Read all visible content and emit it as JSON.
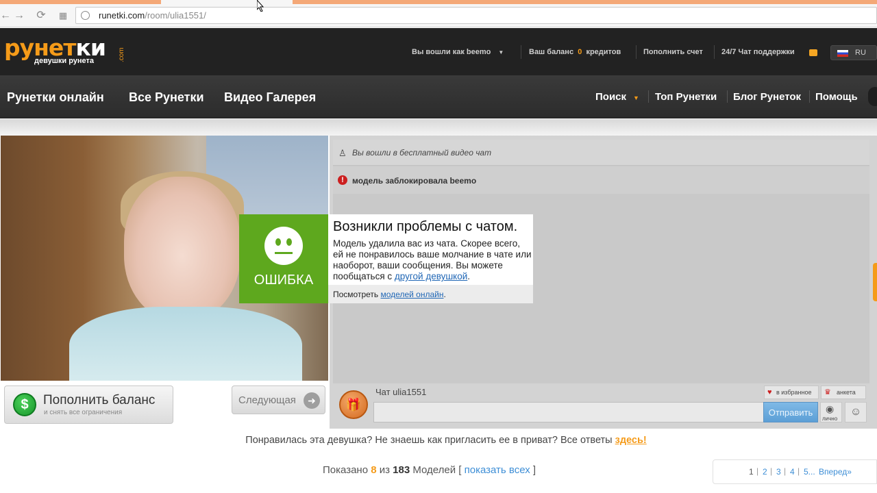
{
  "browser": {
    "url_domain": "runetki.com",
    "url_path": "/room/ulia1551/"
  },
  "header": {
    "logo_word_a": "рунет",
    "logo_word_b": "ки",
    "logo_com": ".com",
    "logo_tagline": "девушки рунета",
    "logged_in_as": "Вы вошли как beemo",
    "balance_label": "Ваш баланс",
    "balance_value": "0",
    "balance_unit": "кредитов",
    "topup": "Пополнить счет",
    "support": "24/7 Чат поддержки",
    "lang": "RU"
  },
  "nav": {
    "left": [
      "Рунетки онлайн",
      "Все Рунетки",
      "Видео Галерея"
    ],
    "search": "Поиск",
    "right": [
      "Топ Рунетки",
      "Блог Рунеток",
      "Помощь"
    ]
  },
  "video": {
    "topup_title": "Пополнить баланс",
    "topup_sub": "и снять все ограничения",
    "next": "Следующая"
  },
  "chat": {
    "msg_free": "Вы вошли в бесплатный видео чат",
    "msg_blocked": "модель заблокировала beemo",
    "title": "Чат ulia1551",
    "fav": "в избранное",
    "profile": "анкета",
    "send": "Отправить",
    "private": "лично"
  },
  "error": {
    "badge": "ОШИБКА",
    "title": "Возникли проблемы с чатом.",
    "body": "Модель удалила вас из чата. Скорее всего, ей не понравилось ваше молчание в чате или наоборот, ваши сообщения. Вы можете пообщаться с",
    "body_link": "другой девушкой",
    "body_end": ".",
    "foot": "Посмотреть",
    "foot_link": "моделей онлайн",
    "foot_end": "."
  },
  "footer": {
    "promo": "Понравилась эта девушка? Не знаешь как пригласить ее в приват? Все ответы",
    "promo_link": "здесь!",
    "shown_pre": "Показано",
    "shown_num": "8",
    "shown_mid": "из",
    "shown_total": "183",
    "shown_models": "Моделей [",
    "show_all": "показать всех",
    "shown_end": "]",
    "pages": [
      "1",
      "2",
      "3",
      "4",
      "5..."
    ],
    "forward": "Вперед»"
  },
  "colors": {
    "accent_orange": "#f59b19",
    "error_green": "#5ea81e",
    "link_blue": "#1f66b5"
  }
}
